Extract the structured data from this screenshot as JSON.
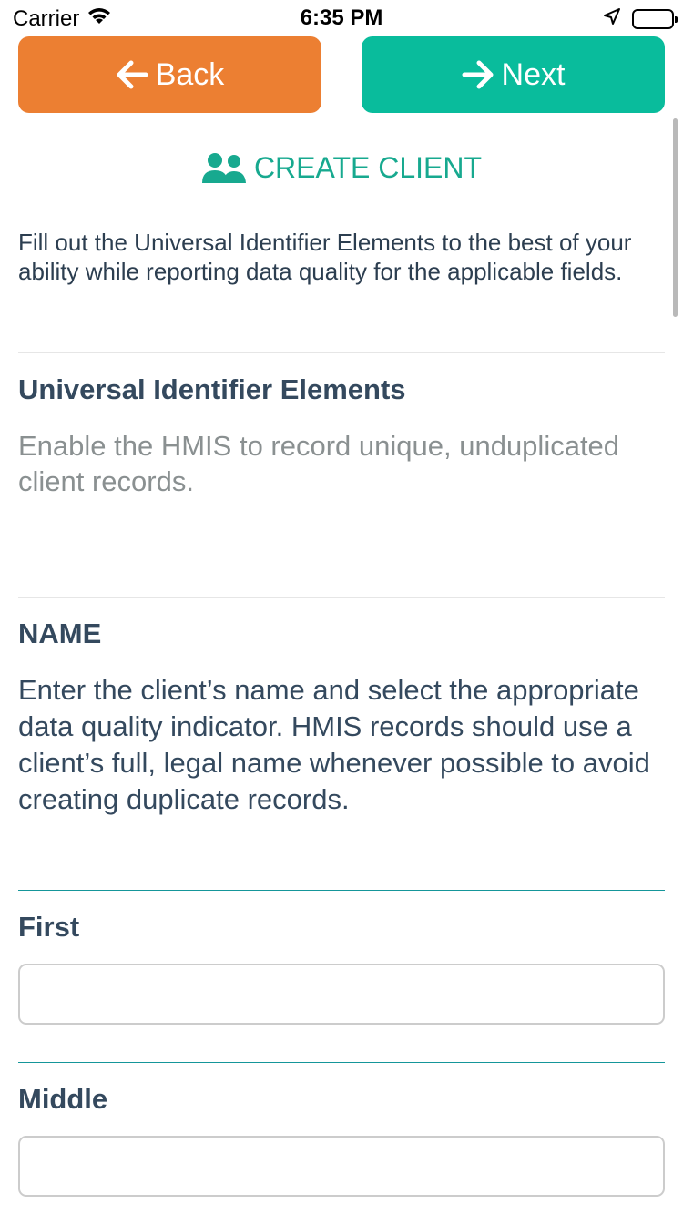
{
  "status_bar": {
    "carrier": "Carrier",
    "time": "6:35 PM"
  },
  "nav": {
    "back_label": "Back",
    "next_label": "Next",
    "back_color": "#ec7f32",
    "next_color": "#09bc9c"
  },
  "header": {
    "title": "CREATE CLIENT",
    "icon": "users-icon",
    "color": "#17a98f"
  },
  "intro": {
    "text": "Fill out the Universal Identifier Elements to the best of your ability while reporting data quality for the applicable fields."
  },
  "section": {
    "title": "Universal Identifier Elements",
    "description": "Enable the HMIS to record unique, unduplicated client records."
  },
  "name_section": {
    "title": "NAME",
    "description": "Enter the client’s name and select the appropriate data quality indicator. HMIS records should use a client’s full, legal name whenever possible to avoid creating duplicate records."
  },
  "fields": {
    "first_label": "First",
    "first_value": "",
    "middle_label": "Middle",
    "middle_value": ""
  }
}
